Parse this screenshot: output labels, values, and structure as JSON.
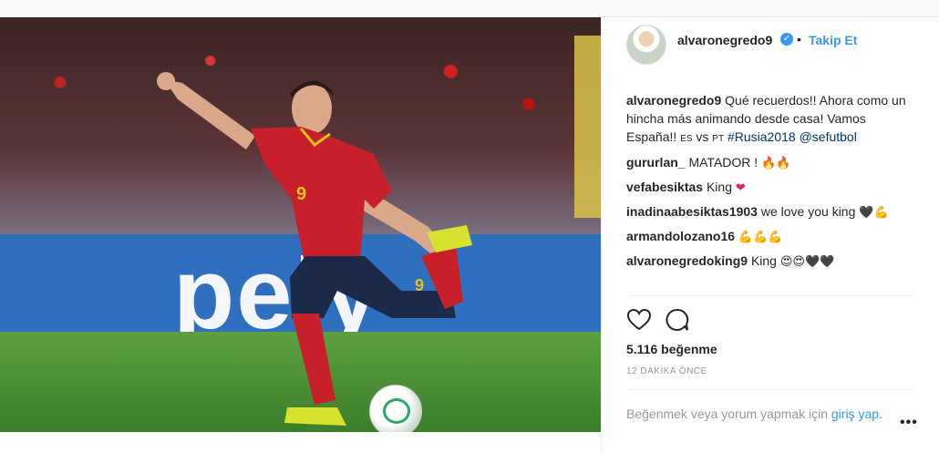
{
  "post": {
    "image_alt": "Soccer player in red Spain kit striking ball",
    "board_text": "pely",
    "jersey_number": "9"
  },
  "header": {
    "username": "alvaronegredo9",
    "verified_mark": "✓",
    "separator": "•",
    "follow_label": "Takip Et"
  },
  "caption": {
    "username": "alvaronegredo9",
    "text": "Qué recuerdos!! Ahora como un hincha más animando desde casa! Vamos España!!",
    "small_es": "ES",
    "vs": "vs",
    "small_pt": "PT",
    "hashtag": "#Rusia2018",
    "mention": "@sefutbol"
  },
  "comments": [
    {
      "username": "gururlan_",
      "text": "MATADOR !",
      "emoji": "🔥🔥"
    },
    {
      "username": "vefabesiktas",
      "text": "King",
      "emoji": "❤"
    },
    {
      "username": "inadinaabesiktas1903",
      "text": "we love you king",
      "emoji": "🖤💪"
    },
    {
      "username": "armandolozano16",
      "text": "",
      "emoji": "💪💪💪"
    },
    {
      "username": "alvaronegredoking9",
      "text": "King",
      "emoji": "😍😍🖤🖤"
    }
  ],
  "actions": {
    "like_icon": "heart-icon",
    "comment_icon": "comment-icon"
  },
  "likes_text": "5.116 beğenme",
  "time_text": "12 DAKİKA ÖNCE",
  "login_prompt": {
    "text": "Beğenmek veya yorum yapmak için",
    "link": "giriş yap."
  },
  "more_options": "•••"
}
